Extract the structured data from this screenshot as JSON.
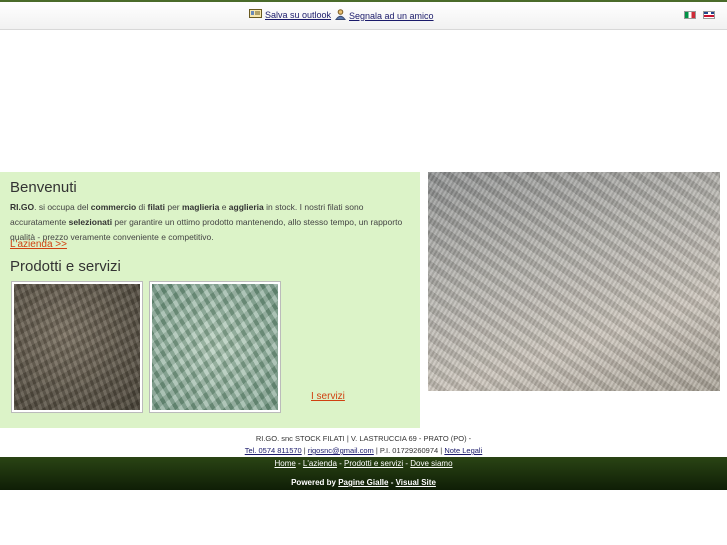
{
  "topbar": {
    "save_outlook": "Salva su outlook",
    "tell_friend": "Segnala ad un amico"
  },
  "languages": [
    {
      "name": "Italiano",
      "icon": "italian-flag-icon"
    },
    {
      "name": "English",
      "icon": "english-flag-icon"
    }
  ],
  "welcome": {
    "title": "Benvenuti",
    "parts": [
      {
        "t": "RI.GO",
        "b": true
      },
      {
        "t": ". si occupa del ",
        "b": false
      },
      {
        "t": "commercio",
        "b": true
      },
      {
        "t": " di ",
        "b": false
      },
      {
        "t": "filati",
        "b": true
      },
      {
        "t": " per ",
        "b": false
      },
      {
        "t": "maglieria",
        "b": true
      },
      {
        "t": " e ",
        "b": false
      },
      {
        "t": "agglieria",
        "b": true
      },
      {
        "t": " in stock. I nostri filati sono accuratamente ",
        "b": false
      },
      {
        "t": "selezionati",
        "b": true
      },
      {
        "t": " per garantire un ottimo prodotto mantenendo, allo stesso tempo,  un rapporto qualità - prezzo veramente conveniente e competitivo.",
        "b": false
      }
    ],
    "link": "L'azienda >>"
  },
  "products": {
    "title": "Prodotti e servizi",
    "link": "I servizi"
  },
  "footer": {
    "company": "RI.GO. snc STOCK FILATI | V. LASTRUCCIA 69 - PRATO (PO) -",
    "tel": "Tel. 0574 811570",
    "sep1": " | ",
    "email": "rigosnc@gmail.com",
    "piva": " | P.I. 01729260974 | ",
    "legal": "Note Legali",
    "nav": [
      "Home",
      "L'azienda",
      "Prodotti e servizi",
      "Dove siamo"
    ],
    "nav_sep": " - ",
    "powered_label": "Powered by ",
    "powered_links": [
      "Pagine Gialle",
      "Visual Site"
    ],
    "powered_sep": " - "
  },
  "colors": {
    "accent_link": "#d04010",
    "panel_green": "#dcf3c8",
    "footer_dark": "#1e3210"
  }
}
